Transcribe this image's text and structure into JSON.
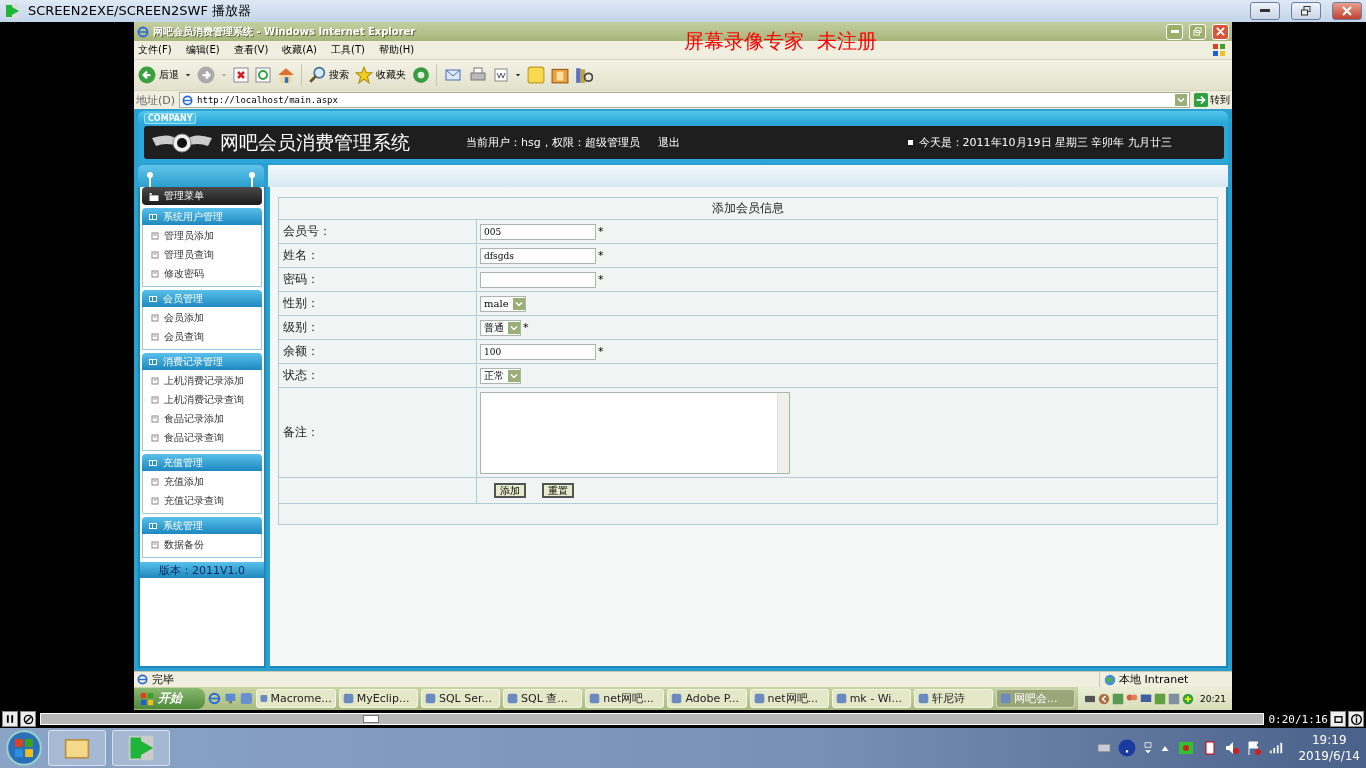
{
  "player": {
    "title": "SCREEN2EXE/SCREEN2SWF 播放器",
    "seek": {
      "level": 0.27
    },
    "time": "0:20/1:16"
  },
  "watermark": "屏幕录像专家  未注册",
  "browser": {
    "title": "网吧会员消费管理系统 - Windows Internet Explorer",
    "menu": [
      "文件(F)",
      "编辑(E)",
      "查看(V)",
      "收藏(A)",
      "工具(T)",
      "帮助(H)"
    ],
    "toolbar": {
      "back": "后退",
      "search": "搜索",
      "favorites": "收藏夹"
    },
    "address": {
      "label": "地址(D)",
      "url": "http://localhost/main.aspx",
      "go": "转到"
    },
    "status": {
      "text": "完毕",
      "zone": "本地 Intranet"
    }
  },
  "page": {
    "header": {
      "badge": "COMPANY",
      "title": "网吧会员消费管理系统",
      "user": "当前用户：hsg，权限：超级管理员",
      "logout": "退出",
      "date": "今天是：2011年10月19日 星期三 辛卯年 九月廿三"
    },
    "sidebar": {
      "title": "管理菜单",
      "sections": [
        {
          "title": "系统用户管理",
          "items": [
            "管理员添加",
            "管理员查询",
            "修改密码"
          ]
        },
        {
          "title": "会员管理",
          "items": [
            "会员添加",
            "会员查询"
          ]
        },
        {
          "title": "消费记录管理",
          "items": [
            "上机消费记录添加",
            "上机消费记录查询",
            "食品记录添加",
            "食品记录查询"
          ]
        },
        {
          "title": "充值管理",
          "items": [
            "充值添加",
            "充值记录查询"
          ]
        },
        {
          "title": "系统管理",
          "items": [
            "数据备份"
          ]
        }
      ],
      "version": "版本：2011V1.0"
    },
    "form": {
      "title": "添加会员信息",
      "fields": [
        {
          "label": "会员号：",
          "kind": "text",
          "value": "005",
          "mark": "*"
        },
        {
          "label": "姓名：",
          "kind": "text",
          "value": "dfsgds",
          "mark": "*"
        },
        {
          "label": "密码：",
          "kind": "text",
          "mark": "*"
        },
        {
          "label": "性别：",
          "kind": "select",
          "value": "male"
        },
        {
          "label": "级别：",
          "kind": "select",
          "value": "普通",
          "mark": "*"
        },
        {
          "label": "余额：",
          "kind": "text",
          "value": "100",
          "mark": "*"
        },
        {
          "label": "状态：",
          "kind": "select",
          "value": "正常"
        },
        {
          "label": "备注：",
          "kind": "textarea"
        }
      ],
      "buttons": [
        "添加",
        "重置"
      ]
    }
  },
  "xp_taskbar": {
    "start": "开始",
    "tasks": [
      {
        "label": "Macrome...",
        "selected": false
      },
      {
        "label": "MyEclip...",
        "selected": false
      },
      {
        "label": "SQL Ser...",
        "selected": false
      },
      {
        "label": "SQL 查...",
        "selected": false
      },
      {
        "label": "net网吧...",
        "selected": false
      },
      {
        "label": "Adobe P...",
        "selected": false
      },
      {
        "label": "net网吧...",
        "selected": false
      },
      {
        "label": "mk - Wi...",
        "selected": false
      },
      {
        "label": "轩尼诗",
        "selected": false
      },
      {
        "label": "网吧会...",
        "selected": true
      }
    ],
    "clock": "20:21"
  },
  "taskbar": {
    "time": "19:19",
    "date": "2019/6/14"
  }
}
